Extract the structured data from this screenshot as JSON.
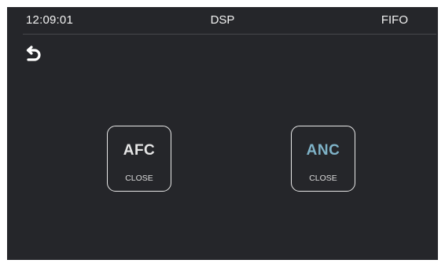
{
  "status_bar": {
    "time": "12:09:01",
    "title": "DSP",
    "mode": "FIFO"
  },
  "back": {
    "icon": "back-arrow-icon"
  },
  "tiles": [
    {
      "name": "AFC",
      "status": "CLOSE",
      "name_color": "#e6e6e6"
    },
    {
      "name": "ANC",
      "status": "CLOSE",
      "name_color": "#7fb3c8"
    }
  ],
  "colors": {
    "background": "#25262a",
    "border": "#e9e9e9",
    "divider": "#46474c"
  }
}
